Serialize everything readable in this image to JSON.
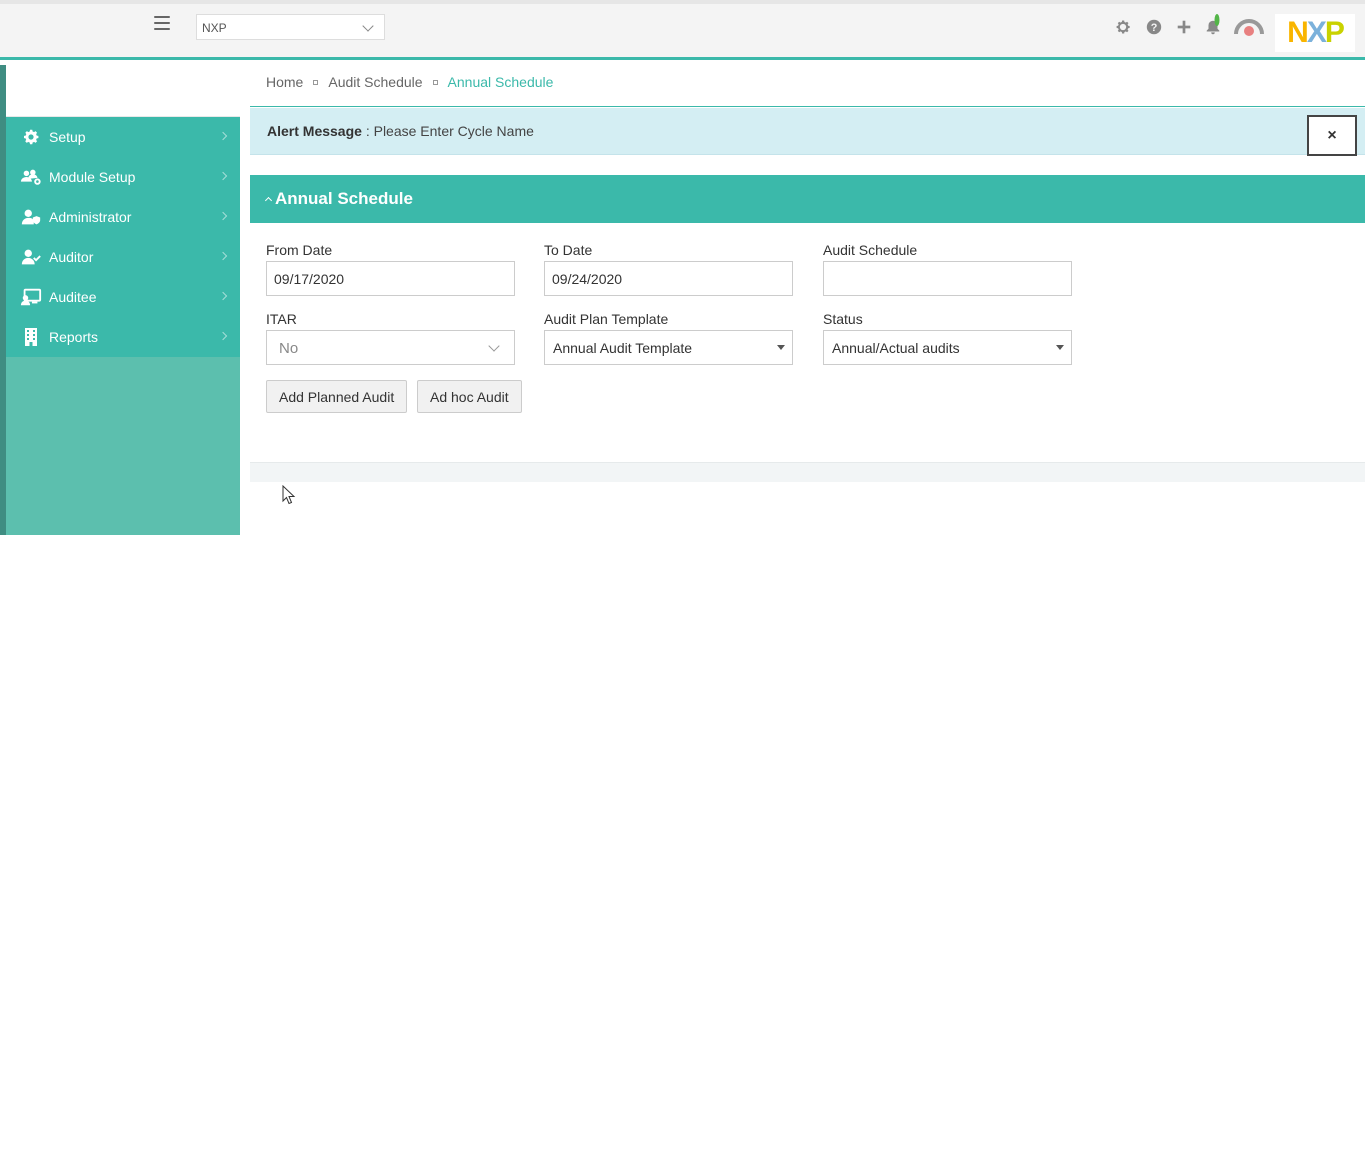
{
  "topbar": {
    "company_select_value": "NXP",
    "logo_text": {
      "n": "N",
      "x": "X",
      "p": "P"
    },
    "icons": [
      "gear-icon",
      "help-icon",
      "plus-icon",
      "bell-icon",
      "avatar"
    ]
  },
  "sidebar": {
    "items": [
      {
        "label": "Setup",
        "icon": "gear-icon"
      },
      {
        "label": "Module Setup",
        "icon": "users-gear-icon"
      },
      {
        "label": "Administrator",
        "icon": "user-shield-icon"
      },
      {
        "label": "Auditor",
        "icon": "user-check-icon"
      },
      {
        "label": "Auditee",
        "icon": "monitor-user-icon"
      },
      {
        "label": "Reports",
        "icon": "building-icon"
      }
    ]
  },
  "breadcrumb": {
    "items": [
      "Home",
      "Audit Schedule"
    ],
    "current": "Annual Schedule"
  },
  "alert": {
    "title": "Alert Message",
    "message": " : Please Enter Cycle Name",
    "close_label": "×"
  },
  "panel": {
    "title": "Annual Schedule"
  },
  "form": {
    "from_date": {
      "label": "From Date",
      "value": "09/17/2020"
    },
    "to_date": {
      "label": "To Date",
      "value": "09/24/2020"
    },
    "audit_schedule": {
      "label": "Audit Schedule",
      "value": ""
    },
    "itar": {
      "label": "ITAR",
      "value": "No"
    },
    "audit_plan_template": {
      "label": "Audit Plan Template",
      "value": "Annual Audit Template"
    },
    "status": {
      "label": "Status",
      "value": "Annual/Actual audits"
    }
  },
  "buttons": {
    "add_planned_audit": "Add Planned Audit",
    "ad_hoc_audit": "Ad hoc Audit"
  },
  "colors": {
    "accent": "#3bb9aa",
    "sidebar_bg": "#5cbfae",
    "alert_bg": "#d4eef3"
  }
}
